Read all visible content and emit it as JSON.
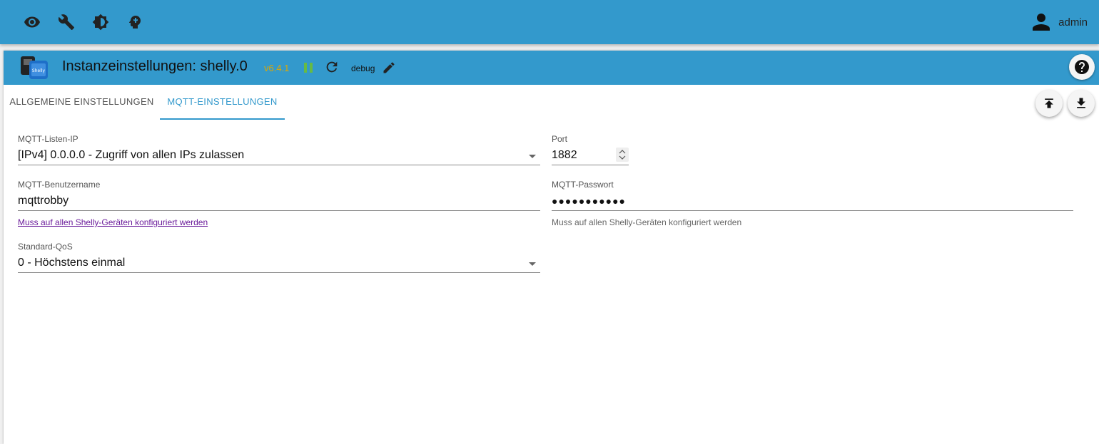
{
  "topbar": {
    "icons": [
      "eye-icon",
      "wrench-icon",
      "brightness-icon",
      "head-icon"
    ],
    "user_name": "admin"
  },
  "instance": {
    "title": "Instanzeinstellungen: shelly.0",
    "version": "v6.4.1",
    "log_level": "debug"
  },
  "tabs": [
    {
      "label": "Allgemeine Einstellungen",
      "active": false
    },
    {
      "label": "MQTT-Einstellungen",
      "active": true
    }
  ],
  "form": {
    "listen_ip": {
      "label": "MQTT-Listen-IP",
      "value": "[IPv4] 0.0.0.0 - Zugriff von allen IPs zulassen"
    },
    "port": {
      "label": "Port",
      "value": "1882"
    },
    "username": {
      "label": "MQTT-Benutzername",
      "value": "mqttrobby",
      "helper": "Muss auf allen Shelly-Geräten konfiguriert werden"
    },
    "password": {
      "label": "MQTT-Passwort",
      "value": "●●●●●●●●●●●",
      "helper": "Muss auf allen Shelly-Geräten konfiguriert werden"
    },
    "qos": {
      "label": "Standard-QoS",
      "value": "0 - Höchstens einmal"
    }
  },
  "colors": {
    "accent": "#3399cc",
    "version": "#e0a800",
    "running": "#66bb44"
  }
}
